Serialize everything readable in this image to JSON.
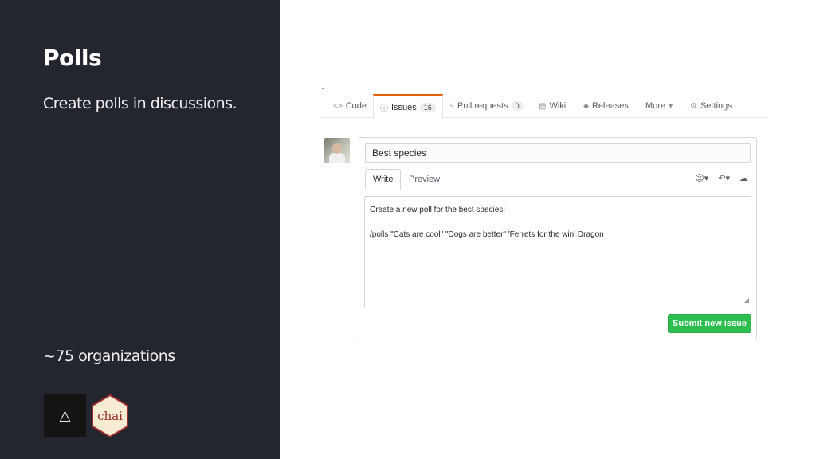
{
  "slide": {
    "title": "Polls",
    "subtitle": "Create polls in discussions.",
    "count": "~75 organizations",
    "logo_triangle": "△",
    "logo_chai": "chai"
  },
  "repo_tabs": [
    {
      "label": "Code",
      "icon": "code-icon",
      "glyph": "<>"
    },
    {
      "label": "Issues",
      "icon": "issue-icon",
      "glyph": "ⓘ",
      "counter": "16"
    },
    {
      "label": "Pull requests",
      "icon": "pull-request-icon",
      "glyph": "⑂",
      "counter": "0"
    },
    {
      "label": "Wiki",
      "icon": "book-icon",
      "glyph": "▤"
    },
    {
      "label": "Releases",
      "icon": "tag-icon",
      "glyph": "⬥"
    },
    {
      "label": "More",
      "icon": "chevron-down-icon",
      "glyph": "▾"
    },
    {
      "label": "Settings",
      "icon": "gear-icon",
      "glyph": "⚙"
    }
  ],
  "issue": {
    "title_value": "Best species",
    "tab_write": "Write",
    "tab_preview": "Preview",
    "body_line1": "Create a new poll for the best species:",
    "body_line2": "/polls \"Cats are cool\" \"Dogs are better\" 'Ferrets for the win' Dragon",
    "submit_label": "Submit new issue"
  },
  "toolbar_icons": [
    "mention-icon",
    "reply-icon",
    "upload-icon"
  ],
  "colors": {
    "panel_bg": "#23262e",
    "submit_bg": "#2cbe4e",
    "active_tab_accent": "#e36209"
  }
}
